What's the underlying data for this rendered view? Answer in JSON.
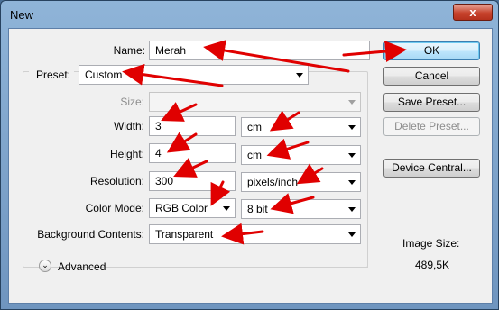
{
  "window": {
    "title": "New",
    "close_glyph": "x"
  },
  "form": {
    "name_label": "Name:",
    "name_value": "Merah",
    "preset_label": "Preset:",
    "preset_value": "Custom",
    "size_label": "Size:",
    "width_label": "Width:",
    "width_value": "3",
    "width_unit": "cm",
    "height_label": "Height:",
    "height_value": "4",
    "height_unit": "cm",
    "resolution_label": "Resolution:",
    "resolution_value": "300",
    "resolution_unit": "pixels/inch",
    "color_mode_label": "Color Mode:",
    "color_mode_value": "RGB Color",
    "bit_depth_value": "8 bit",
    "background_label": "Background Contents:",
    "background_value": "Transparent",
    "advanced_label": "Advanced",
    "advanced_glyph": "⌄"
  },
  "buttons": {
    "ok": "OK",
    "cancel": "Cancel",
    "save_preset": "Save Preset...",
    "delete_preset": "Delete Preset...",
    "device_central": "Device Central..."
  },
  "info": {
    "image_size_label": "Image Size:",
    "image_size_value": "489,5K"
  },
  "annotations": {
    "arrow_color": "#e00000"
  }
}
